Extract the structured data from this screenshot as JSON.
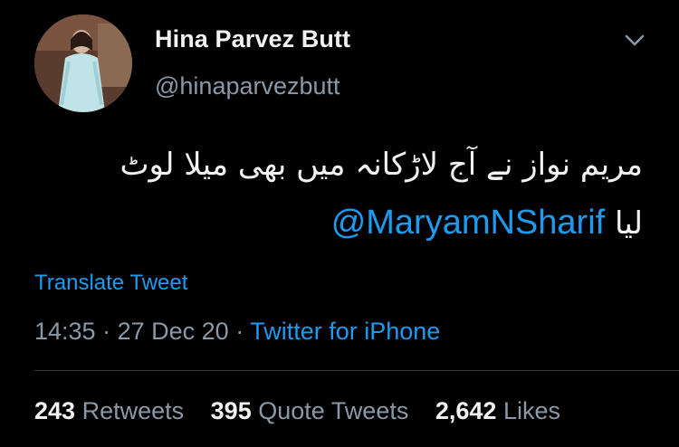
{
  "tweet": {
    "author": {
      "name": "Hina Parvez Butt",
      "handle": "@hinaparvezbutt"
    },
    "text_line1": "مریم نواز نے آج لاڑکانہ میں بھی میلا لوٹ",
    "text_line2_prefix": "لیا",
    "mention": "@MaryamNSharif",
    "translate_label": "Translate Tweet",
    "time": "14:35",
    "separator": "·",
    "date": "27 Dec 20",
    "source": "Twitter for iPhone",
    "stats": {
      "retweets_count": "243",
      "retweets_label": "Retweets",
      "quotes_count": "395",
      "quotes_label": "Quote Tweets",
      "likes_count": "2,642",
      "likes_label": "Likes"
    }
  },
  "colors": {
    "background": "#000000",
    "primary_text": "#f2f2f2",
    "secondary_text": "#8b98a5",
    "accent": "#1d9bf0"
  },
  "icons": {
    "caret": "chevron-down-icon",
    "avatar": "avatar"
  }
}
